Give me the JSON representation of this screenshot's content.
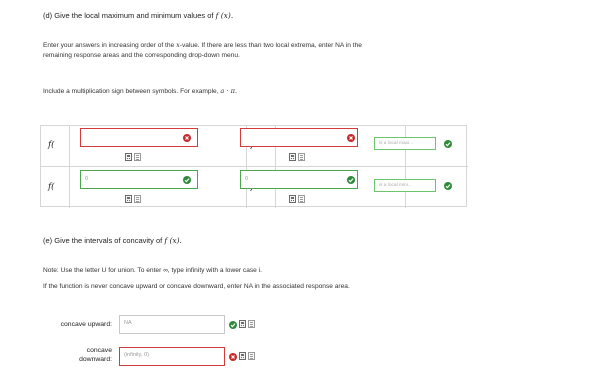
{
  "part_d": {
    "heading_prefix": "(d) Give the local maximum and minimum values of",
    "heading_math": "f (x).",
    "instructions_line1_a": "Enter your answers in increasing order of the",
    "instructions_line1_math": "x",
    "instructions_line1_b": "-value. If there are less than two local extrema, enter NA in the",
    "instructions_line2": "remaining response areas and the corresponding drop-down menu.",
    "hint_prefix": "Include a multiplication sign between symbols. For example,",
    "hint_math": "a · π.",
    "rows": [
      {
        "fx_label": "f(",
        "eq_label": ")=",
        "x_value": "",
        "f_value": "",
        "x_status": "error",
        "f_status": "error",
        "dropdown_value": "is a local maxi...",
        "dropdown_status": "correct"
      },
      {
        "fx_label": "f(",
        "eq_label": ")=",
        "x_value": "0",
        "f_value": "0",
        "x_status": "correct",
        "f_status": "correct",
        "dropdown_value": "is a local mini...",
        "dropdown_status": "correct"
      }
    ]
  },
  "part_e": {
    "heading_prefix": "(e) Give the intervals of concavity of",
    "heading_math": "f (x).",
    "note_line1": "Note: Use the letter U for union. To enter ∞, type infinity with a lower case i.",
    "note_line2": "If the function is never concave upward or concave downward, enter NA in the associated response area.",
    "upward_label": "concave upward:",
    "upward_value": "NA",
    "downward_label_line1": "concave",
    "downward_label_line2": "downward:",
    "downward_value": "(infinity, 0)"
  },
  "colors": {
    "error": "#c72a2a",
    "correct": "#2e8b3a",
    "error_border": "#d33a3a",
    "correct_border": "#4aa84a"
  },
  "icons": {
    "calculator": "calculator-icon",
    "help": "help-document-icon",
    "error": "x-circle-icon",
    "correct": "check-circle-icon"
  }
}
